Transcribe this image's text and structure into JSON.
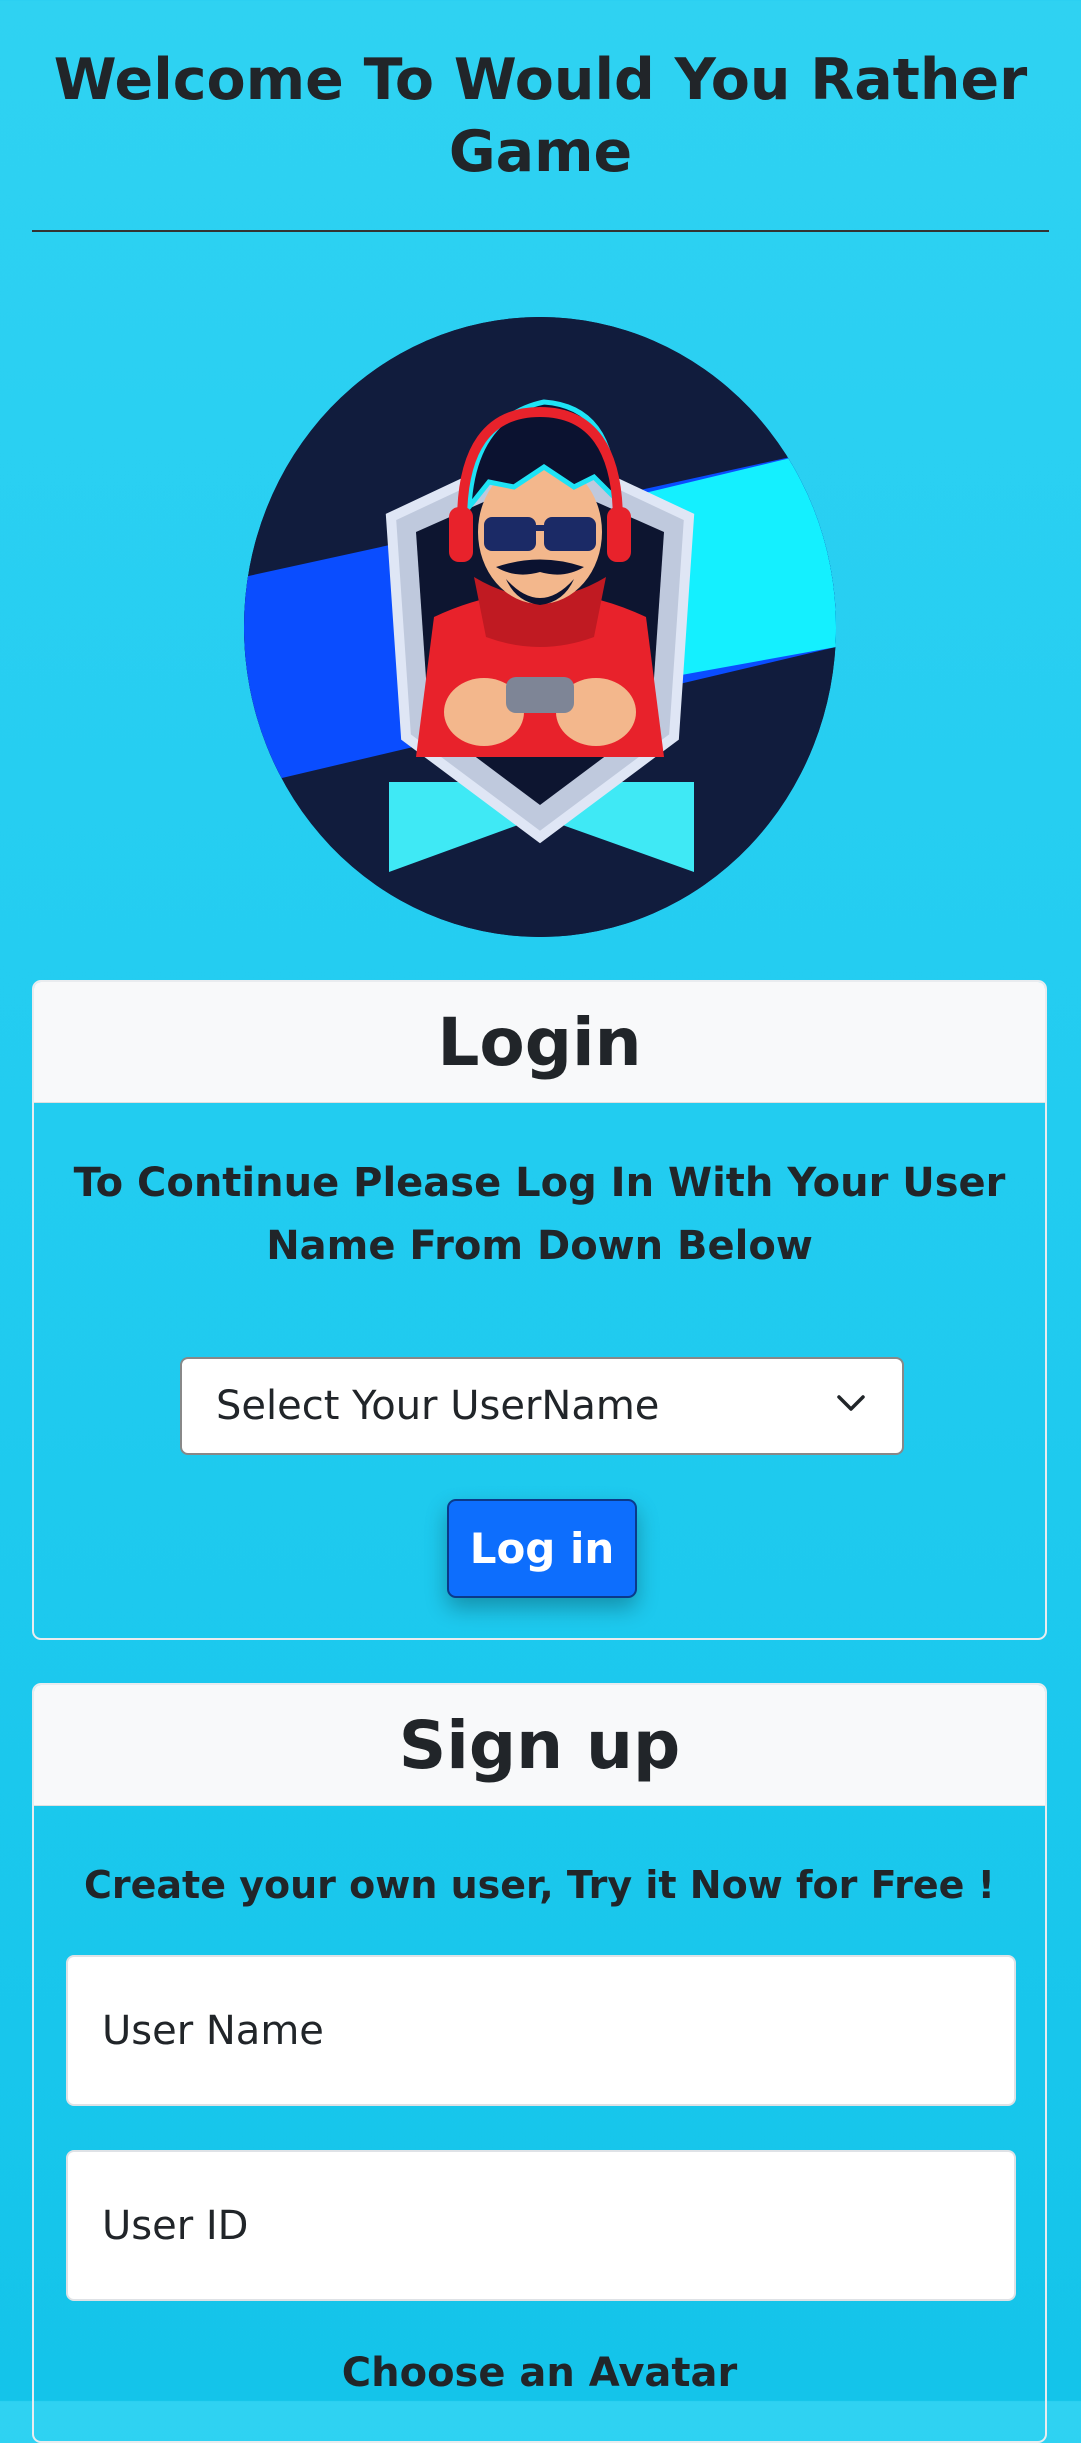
{
  "header": {
    "title": "Welcome To Would You Rather Game"
  },
  "hero": {
    "image": "gamer-mascot-logo"
  },
  "login": {
    "heading": "Login",
    "message": "To Continue Please Log In With Your User Name From Down Below",
    "select_value": "Select Your UserName",
    "button_label": "Log in"
  },
  "signup": {
    "heading": "Sign up",
    "message": "Create your own user, Try it Now for Free !",
    "username_placeholder": "User Name",
    "userid_placeholder": "User ID",
    "avatar_label": "Choose an Avatar"
  },
  "colors": {
    "background": "#24cdf1",
    "primary_button": "#0d6efd",
    "card_header": "#f8f9fa"
  }
}
